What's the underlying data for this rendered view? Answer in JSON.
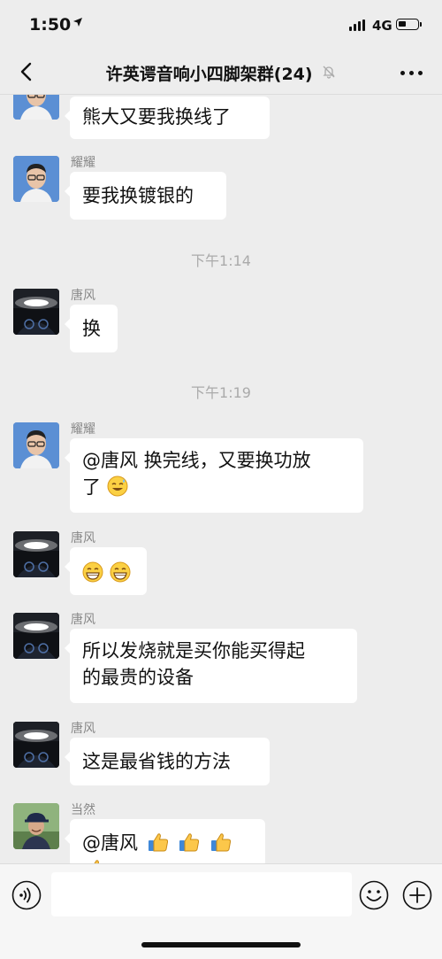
{
  "status": {
    "time": "1:50",
    "network": "4G"
  },
  "header": {
    "title": "许英谔音响小四脚架群(24)"
  },
  "messages": [
    {
      "sender": "",
      "text": "熊大又要我换线了"
    },
    {
      "sender": "耀耀",
      "text": "要我换镀银的"
    },
    {
      "timestamp": "下午1:14"
    },
    {
      "sender": "唐风",
      "text": "换"
    },
    {
      "timestamp": "下午1:19"
    },
    {
      "sender": "耀耀",
      "line1": "@唐风  换完线，又要换功放",
      "line2": "了"
    },
    {
      "sender": "唐风"
    },
    {
      "sender": "唐风",
      "line1": "所以发烧就是买你能买得起",
      "line2": "的最贵的设备"
    },
    {
      "sender": "唐风",
      "text": "这是最省钱的方法"
    },
    {
      "sender": "当然",
      "text": "@唐风 "
    }
  ],
  "input": {
    "placeholder": ""
  },
  "icons": {
    "back": "chevron-left-icon",
    "mute": "bell-slash-icon",
    "more": "ellipsis-icon",
    "voice": "voice-icon",
    "emoji": "smiley-icon",
    "plus": "plus-icon"
  },
  "colors": {
    "background": "#ededed",
    "bubble": "#ffffff",
    "sender": "#888888",
    "timestamp": "#aaaaaa"
  }
}
